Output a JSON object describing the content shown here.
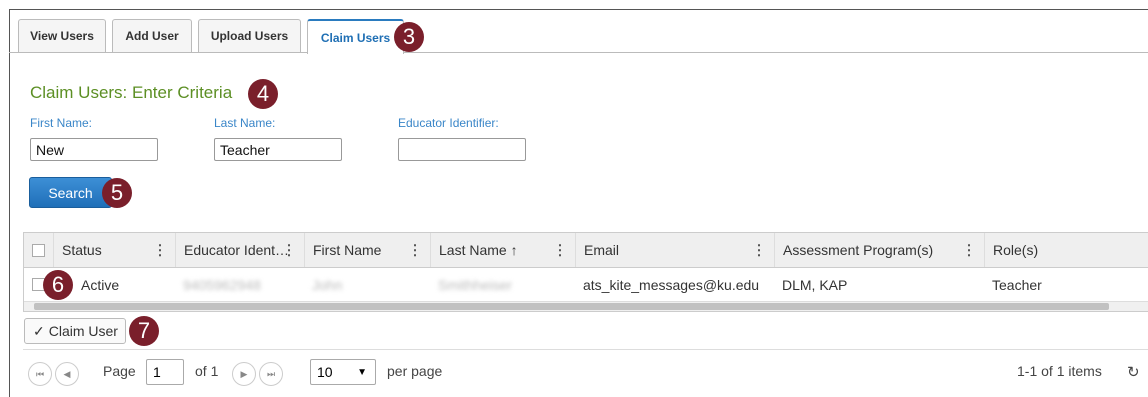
{
  "tabs": [
    {
      "label": "View Users"
    },
    {
      "label": "Add User"
    },
    {
      "label": "Upload Users"
    },
    {
      "label": "Claim Users"
    }
  ],
  "badges": {
    "b3": "3",
    "b4": "4",
    "b5": "5",
    "b6": "6",
    "b7": "7"
  },
  "heading": "Claim Users: Enter Criteria",
  "form": {
    "first_name_label": "First Name:",
    "first_name_value": "New",
    "last_name_label": "Last Name:",
    "last_name_value": "Teacher",
    "educator_id_label": "Educator Identifier:",
    "educator_id_value": "",
    "search_label": "Search"
  },
  "grid": {
    "columns": [
      "Status",
      "Educator Ident…",
      "First Name",
      "Last Name ↑",
      "Email",
      "Assessment Program(s)",
      "Role(s)"
    ],
    "rows": [
      [
        "Active",
        "9405962948",
        "John",
        "Smithheiser",
        "ats_kite_messages@ku.edu",
        "DLM, KAP",
        "Teacher"
      ]
    ]
  },
  "claim_button_label": "Claim User",
  "pager": {
    "page_label": "Page",
    "page_value": "1",
    "of_label": "of 1",
    "page_size": "10",
    "per_page_label": "per page",
    "items_label": "1-1 of 1 items"
  },
  "icons": {
    "first": "first-page-icon",
    "prev": "prev-page-icon",
    "next": "next-page-icon",
    "last": "last-page-icon",
    "refresh": "refresh-icon",
    "check": "check-icon",
    "caret": "caret-down-icon"
  },
  "colors": {
    "accent": "#2a7bbf",
    "heading": "#5c8f24",
    "badge": "#7a1f2b",
    "label": "#3a86c8"
  }
}
